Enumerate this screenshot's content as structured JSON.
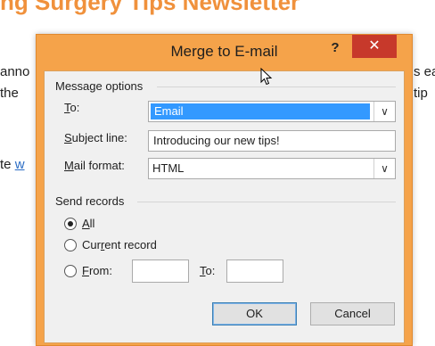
{
  "document": {
    "heading": "ng Surgery Tips Newsletter",
    "fragments": {
      "line1_left": "anno",
      "line2_left": "the",
      "line1_right": "s ea",
      "line2_right": "tip",
      "line3_left": "te",
      "line3_link": "w"
    }
  },
  "dialog": {
    "title": "Merge to E-mail",
    "help_glyph": "?",
    "close_glyph": "✕",
    "message_options": {
      "group_label": "Message options",
      "to": {
        "label_u": "T",
        "label_rest": "o:",
        "value": "Email",
        "arrow": "∨"
      },
      "subject": {
        "label_u": "S",
        "label_rest": "ubject line:",
        "value": "Introducing our new tips!"
      },
      "mail_format": {
        "label_u": "M",
        "label_rest": "ail format:",
        "value": "HTML",
        "arrow": "∨"
      }
    },
    "send_records": {
      "group_label": "Send records",
      "all": {
        "label_u": "A",
        "label_rest": "ll",
        "selected": true
      },
      "current": {
        "label_pre": "Cur",
        "label_u": "r",
        "label_rest": "ent record",
        "selected": false
      },
      "from": {
        "label_u": "F",
        "label_rest": "rom:",
        "value": "",
        "selected": false
      },
      "to": {
        "label_u": "T",
        "label_rest": "o:",
        "value": ""
      }
    },
    "buttons": {
      "ok": "OK",
      "cancel": "Cancel"
    }
  },
  "colors": {
    "accent_orange": "#f5a34a",
    "close_red": "#c7392b",
    "selection_blue": "#3399ff",
    "heading_orange": "#f0913c"
  }
}
